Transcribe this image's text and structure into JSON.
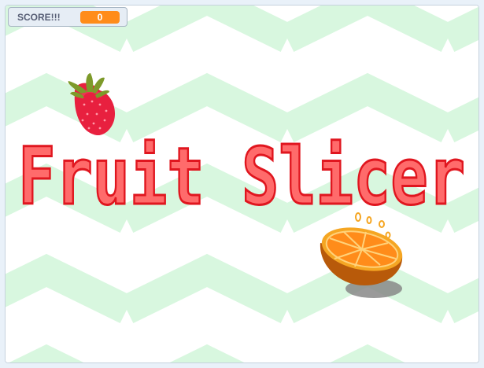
{
  "score_monitor": {
    "label": "SCORE!!!",
    "value": "0"
  },
  "title": {
    "text": "Fruit Slicer"
  },
  "sprites": {
    "strawberry": "strawberry-icon",
    "orange": "orange-half-icon"
  },
  "colors": {
    "title_fill": "#ff6b6b",
    "title_outline": "#e0161f",
    "zigzag": "#d8f7df",
    "score_accent": "#ff8c1a"
  }
}
